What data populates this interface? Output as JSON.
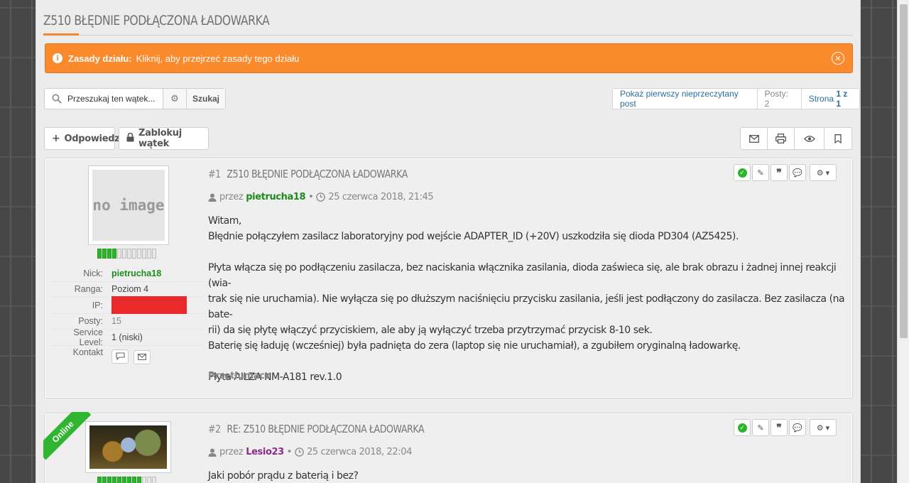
{
  "page_title": "Z510 BŁĘDNIE PODŁĄCZONA ŁADOWARKA",
  "notice": {
    "label": "Zasady działu:",
    "text": "Kliknij, aby przejrzeć zasady tego działu"
  },
  "search": {
    "placeholder": "Przeszukaj ten wątek...",
    "button": "Szukaj"
  },
  "pager": {
    "first_unread": "Pokaż pierwszy nieprzeczytany post",
    "posts_count": "Posty: 2",
    "page_label": "Strona",
    "page_current": "1 z 1"
  },
  "toolbar": {
    "reply": "Odpowiedz",
    "lock": "Zablokuj wątek"
  },
  "posts": [
    {
      "number": "#1",
      "title": "Z510 BŁĘDNIE PODŁĄCZONA ŁADOWARKA",
      "by": "przez",
      "author": "pietrucha18",
      "date": "25 czerwca 2018, 21:45",
      "avatar_text": "no image",
      "rep_level": 4,
      "rep_total": 12,
      "info": {
        "nick_label": "Nick:",
        "nick": "pietrucha18",
        "rank_label": "Ranga:",
        "rank": "Poziom 4",
        "ip_label": "IP:",
        "posts_label": "Posty:",
        "posts": "15",
        "service_label": "Service Level:",
        "service": "1 (niski)",
        "contact_label": "Kontakt"
      },
      "body": [
        "Witam,",
        "Błędnie połączyłem zasilacz laboratoryjny pod wejście ADAPTER_ID (+20V) uszkodziła się dioda PD304 (AZ5425).",
        "",
        "Płyta włącza się po podłączeniu zasilacza, bez naciskania włącznika zasilania, dioda zaświeca się, ale brak obrazu i żadnej innej reakcji (wia-",
        "trak się nie uruchamia). Nie wyłącza się po dłuższym naciśnięciu przycisku zasilania, jeśli jest podłączony do zasilacza. Bez zasilacza (na bate-",
        "rii) da się płytę włączyć przyciskiem, ale aby ją wyłączyć trzeba przytrzymać przycisk 8-10 sek.",
        "Baterię się ładuję (wcześniej) była padnięta do zera (laptop się nie uruchamiał), a zgubiłem oryginalną ładowarkę.",
        "",
        "Płyta AILZA NM-A181 rev.1.0"
      ],
      "translate": "Przetłumacz"
    },
    {
      "number": "#2",
      "title": "RE: Z510 BŁĘDNIE PODŁĄCZONA ŁADOWARKA",
      "by": "przez",
      "author": "Lesio23",
      "date": "25 czerwca 2018, 22:04",
      "ribbon": "Online",
      "rep_level": 9,
      "rep_total": 12,
      "body": [
        "Jaki pobór prądu z baterią i bez?"
      ]
    }
  ],
  "colors": {
    "accent": "#fb8a2d",
    "online": "#2fb52f",
    "author1": "#1c8c1c",
    "author2": "#8b2b8b",
    "ip_redaction": "#e82a2a"
  }
}
